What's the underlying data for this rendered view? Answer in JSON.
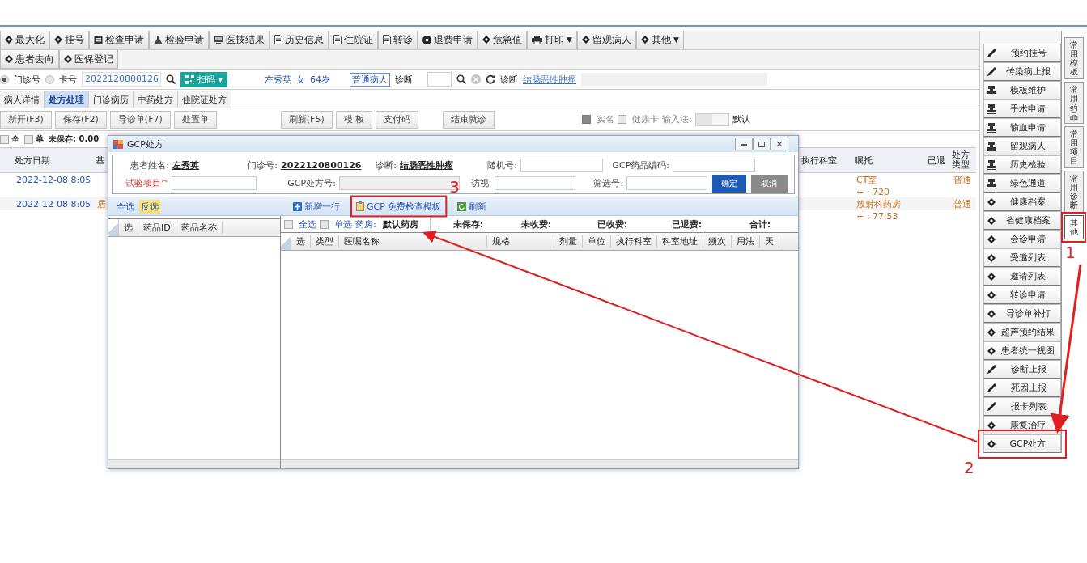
{
  "toolbar": {
    "row_1": [
      {
        "label": "最大化"
      },
      {
        "label": "挂号"
      },
      {
        "label": "检查申请"
      },
      {
        "label": "检验申请"
      },
      {
        "label": "医技结果"
      },
      {
        "label": "历史信息"
      },
      {
        "label": "住院证"
      },
      {
        "label": "转诊"
      },
      {
        "label": "退费申请"
      },
      {
        "label": "危急值"
      },
      {
        "label": "打印",
        "caret": "▼"
      },
      {
        "label": "留观病人"
      },
      {
        "label": "其他",
        "caret": "▼"
      }
    ],
    "row_2": [
      {
        "label": "患者去向"
      },
      {
        "label": "医保登记"
      }
    ]
  },
  "patient_bar": {
    "id_types": [
      {
        "label": "门诊号",
        "selected": true
      },
      {
        "label": "卡号",
        "selected": false
      }
    ],
    "card_number": "2022120800126",
    "scan_button": {
      "label": "扫码",
      "caret": "▾"
    },
    "name": "左秀英",
    "sex": "女",
    "age": "64岁",
    "patient_type": "普通病人",
    "diagnosis_label": "诊断",
    "diagnosis_label_2": "诊断",
    "diagnosis": "结肠恶性肿瘤"
  },
  "tabs": [
    {
      "label": "病人详情",
      "selected": false
    },
    {
      "label": "处方处理",
      "selected": true
    },
    {
      "label": "门诊病历",
      "selected": false
    },
    {
      "label": "中药处方",
      "selected": false
    },
    {
      "label": "住院证处方",
      "selected": false
    }
  ],
  "actions": {
    "left": [
      "新开(F3)",
      "保存(F2)",
      "导诊单(F7)",
      "处置单"
    ],
    "middle": [
      "刷新(F5)",
      "模 板",
      "支付码"
    ],
    "end_visit": "结束就诊",
    "options": [
      {
        "label": "实名",
        "checked": true
      },
      {
        "label": "健康卡",
        "checked": false
      }
    ],
    "input_method_label": "输入法:",
    "input_method_toggle": {
      "on": false
    },
    "input_method_value": "默认"
  },
  "summary": {
    "checks": [
      {
        "label": "全",
        "checked": false
      },
      {
        "label": "单",
        "checked": false
      }
    ],
    "unsaved": "未保存: 0.00"
  },
  "prescription_table": {
    "columns": [
      "处方日期",
      "基",
      "执行科室",
      "嘱托",
      "已退",
      "处方类型"
    ],
    "rows": [
      {
        "date": "2022-12-08 8:05",
        "dept": "CT室",
        "type": "普通",
        "subtotal": "+ : 720"
      },
      {
        "date": "2022-12-08 8:05",
        "column_2": "居",
        "dept": "放射科药房",
        "type": "普通",
        "subtotal": "+ : 77.53"
      }
    ]
  },
  "side_panel": {
    "items": [
      {
        "label": "预约挂号"
      },
      {
        "label": "传染病上报"
      },
      {
        "label": "模板维护"
      },
      {
        "label": "手术申请"
      },
      {
        "label": "输血申请"
      },
      {
        "label": "留观病人"
      },
      {
        "label": "历史检验"
      },
      {
        "label": "绿色通道"
      },
      {
        "label": "健康档案"
      },
      {
        "label": "省健康档案"
      },
      {
        "label": "会诊申请"
      },
      {
        "label": "受邀列表"
      },
      {
        "label": "邀请列表"
      },
      {
        "label": "转诊申请"
      },
      {
        "label": "导诊单补打"
      },
      {
        "label": "超声预约结果"
      },
      {
        "label": "患者统一视图"
      },
      {
        "label": "诊断上报"
      },
      {
        "label": "死因上报"
      },
      {
        "label": "报卡列表"
      },
      {
        "label": "康复治疗"
      },
      {
        "label": "GCP处方"
      }
    ]
  },
  "side_tabs": [
    {
      "label": "常用模板",
      "selected": false
    },
    {
      "label": "常用药品",
      "selected": false
    },
    {
      "label": "常用项目",
      "selected": false
    },
    {
      "label": "常用诊断",
      "selected": false
    },
    {
      "label": "其他",
      "selected": true
    }
  ],
  "gcp_dialog": {
    "title": "GCP处方",
    "fields": [
      {
        "label": "患者姓名:",
        "value": "左秀英",
        "kind": "text",
        "required": false
      },
      {
        "label": "门诊号:",
        "value": "2022120800126",
        "kind": "text",
        "required": false
      },
      {
        "label": "诊断:",
        "value": "结肠恶性肿瘤",
        "kind": "text",
        "required": false
      },
      {
        "label": "随机号:",
        "kind": "input",
        "required": false,
        "disabled": false
      },
      {
        "label": "GCP药品编码:",
        "kind": "input",
        "required": false,
        "disabled": false
      },
      {
        "label": "试验项目^",
        "kind": "input",
        "required": true,
        "disabled": false
      },
      {
        "label": "GCP处方号:",
        "kind": "input",
        "required": false,
        "disabled": true
      },
      {
        "label": "访视:",
        "kind": "input",
        "required": false,
        "disabled": false
      },
      {
        "label": "筛选号:",
        "kind": "input",
        "required": false,
        "disabled": false
      }
    ],
    "confirm": "确定",
    "cancel": "取消",
    "left_toolbar": [
      {
        "label": "全选",
        "selected": false
      },
      {
        "label": "反选",
        "selected": true
      }
    ],
    "right_toolbar": [
      "新增一行",
      "GCP 免费检查模板",
      "刷新"
    ],
    "left_columns": [
      "选",
      "药品ID",
      "药品名称"
    ],
    "filters": {
      "checks": [
        {
          "label": "全选",
          "checked": false
        },
        {
          "label": "单选",
          "checked": false
        }
      ],
      "pharmacy_label": "药房:",
      "pharmacy": "默认药房",
      "totals": [
        "未保存:",
        "未收费:",
        "已收费:",
        "已退费:",
        "合计:"
      ]
    },
    "right_columns": [
      "选",
      "类型",
      "医嘱名称",
      "规格",
      "剂量",
      "单位",
      "执行科室",
      "科室地址",
      "频次",
      "用法",
      "天"
    ]
  },
  "annotations": [
    {
      "label": "1"
    },
    {
      "label": "2"
    },
    {
      "label": "3"
    }
  ]
}
